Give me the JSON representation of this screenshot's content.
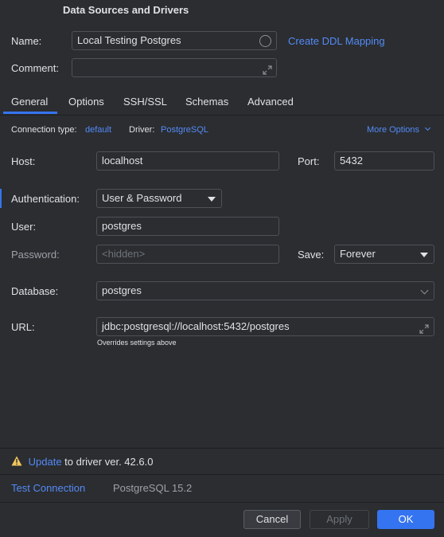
{
  "window": {
    "title": "Data Sources and Drivers"
  },
  "name": {
    "label": "Name:",
    "value": "Local Testing Postgres",
    "ddl_link": "Create DDL Mapping"
  },
  "comment": {
    "label": "Comment:"
  },
  "tabs": [
    {
      "label": "General",
      "active": true
    },
    {
      "label": "Options"
    },
    {
      "label": "SSH/SSL"
    },
    {
      "label": "Schemas"
    },
    {
      "label": "Advanced"
    }
  ],
  "connection": {
    "type_label": "Connection type:",
    "type_value": "default",
    "driver_label": "Driver:",
    "driver_value": "PostgreSQL",
    "more_options": "More Options"
  },
  "host": {
    "label": "Host:",
    "value": "localhost"
  },
  "port": {
    "label": "Port:",
    "value": "5432"
  },
  "auth": {
    "label": "Authentication:",
    "value": "User & Password"
  },
  "user": {
    "label": "User:",
    "value": "postgres"
  },
  "password": {
    "label": "Password:",
    "placeholder": "<hidden>"
  },
  "save": {
    "label": "Save:",
    "value": "Forever"
  },
  "database": {
    "label": "Database:",
    "value": "postgres"
  },
  "url": {
    "label": "URL:",
    "value": "jdbc:postgresql://localhost:5432/postgres",
    "hint": "Overrides settings above"
  },
  "warning": {
    "link": "Update",
    "text": " to driver ver. 42.6.0"
  },
  "footer": {
    "test_connection": "Test Connection",
    "version": "PostgreSQL 15.2"
  },
  "buttons": {
    "cancel": "Cancel",
    "apply": "Apply",
    "ok": "OK"
  },
  "colors": {
    "accent": "#548af7",
    "warning": "#f2c55c",
    "primary_button": "#3574f0"
  }
}
